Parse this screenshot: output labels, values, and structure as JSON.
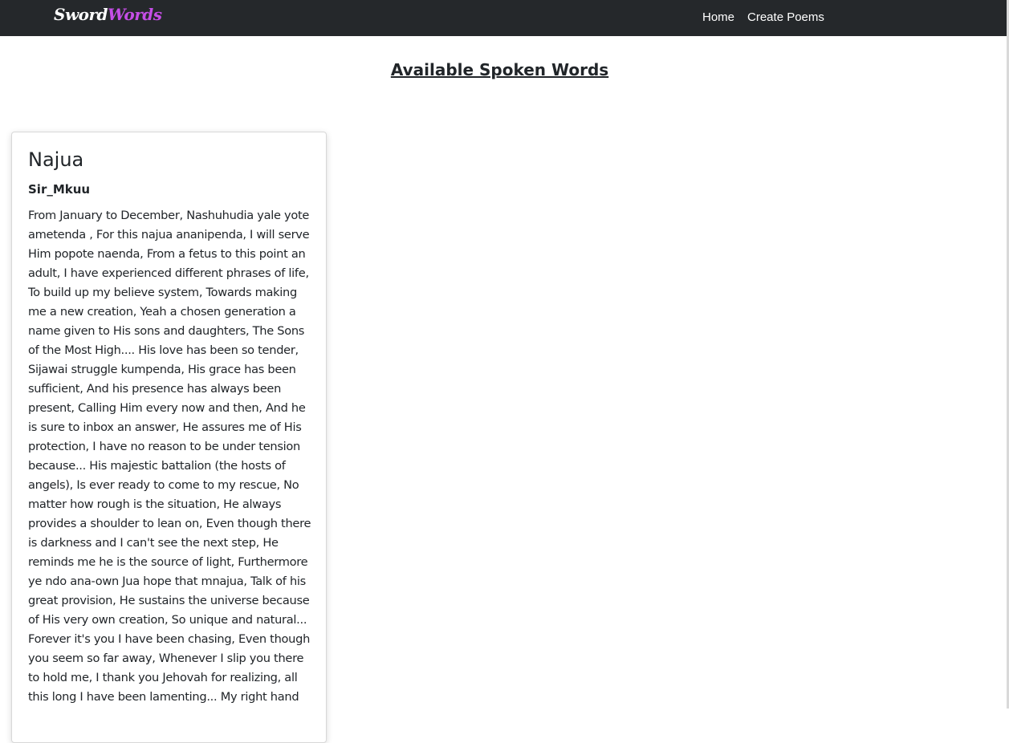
{
  "navbar": {
    "brand_part1": "Sword",
    "brand_part2": "Words",
    "links": [
      "Home",
      "Create Poems"
    ],
    "colors": {
      "background": "#25282b",
      "brand_accent": "#c54ee6",
      "link": "#ffffff"
    }
  },
  "main": {
    "title": "Available Spoken Words"
  },
  "poems": [
    {
      "title": "Najua",
      "author": "Sir_Mkuu",
      "body": "From January to December, Nashuhudia yale yote ametenda , For this najua ananipenda, I will serve Him popote naenda, From a fetus to this point an adult, I have experienced different phrases of life, To build up my believe system, Towards making me a new creation, Yeah a chosen generation a name given to His sons and daughters, The Sons of the Most High.... His love has been so tender, Sijawai struggle kumpenda, His grace has been sufficient, And his presence has always been present, Calling Him every now and then, And he is sure to inbox an answer, He assures me of His protection, I have no reason to be under tension because... His majestic battalion (the hosts of angels), Is ever ready to come to my rescue, No matter how rough is the situation, He always provides a shoulder to lean on, Even though there is darkness and I can't see the next step, He reminds me he is the source of light, Furthermore ye ndo ana-own Jua hope that mnajua, Talk of his great provision, He sustains the universe because of His very own creation, So unique and natural... Forever it's you I have been chasing, Even though you seem so far away, Whenever I slip you there to hold me, I thank you Jehovah for realizing, all this long I have been lamenting... My right hand"
    }
  ]
}
